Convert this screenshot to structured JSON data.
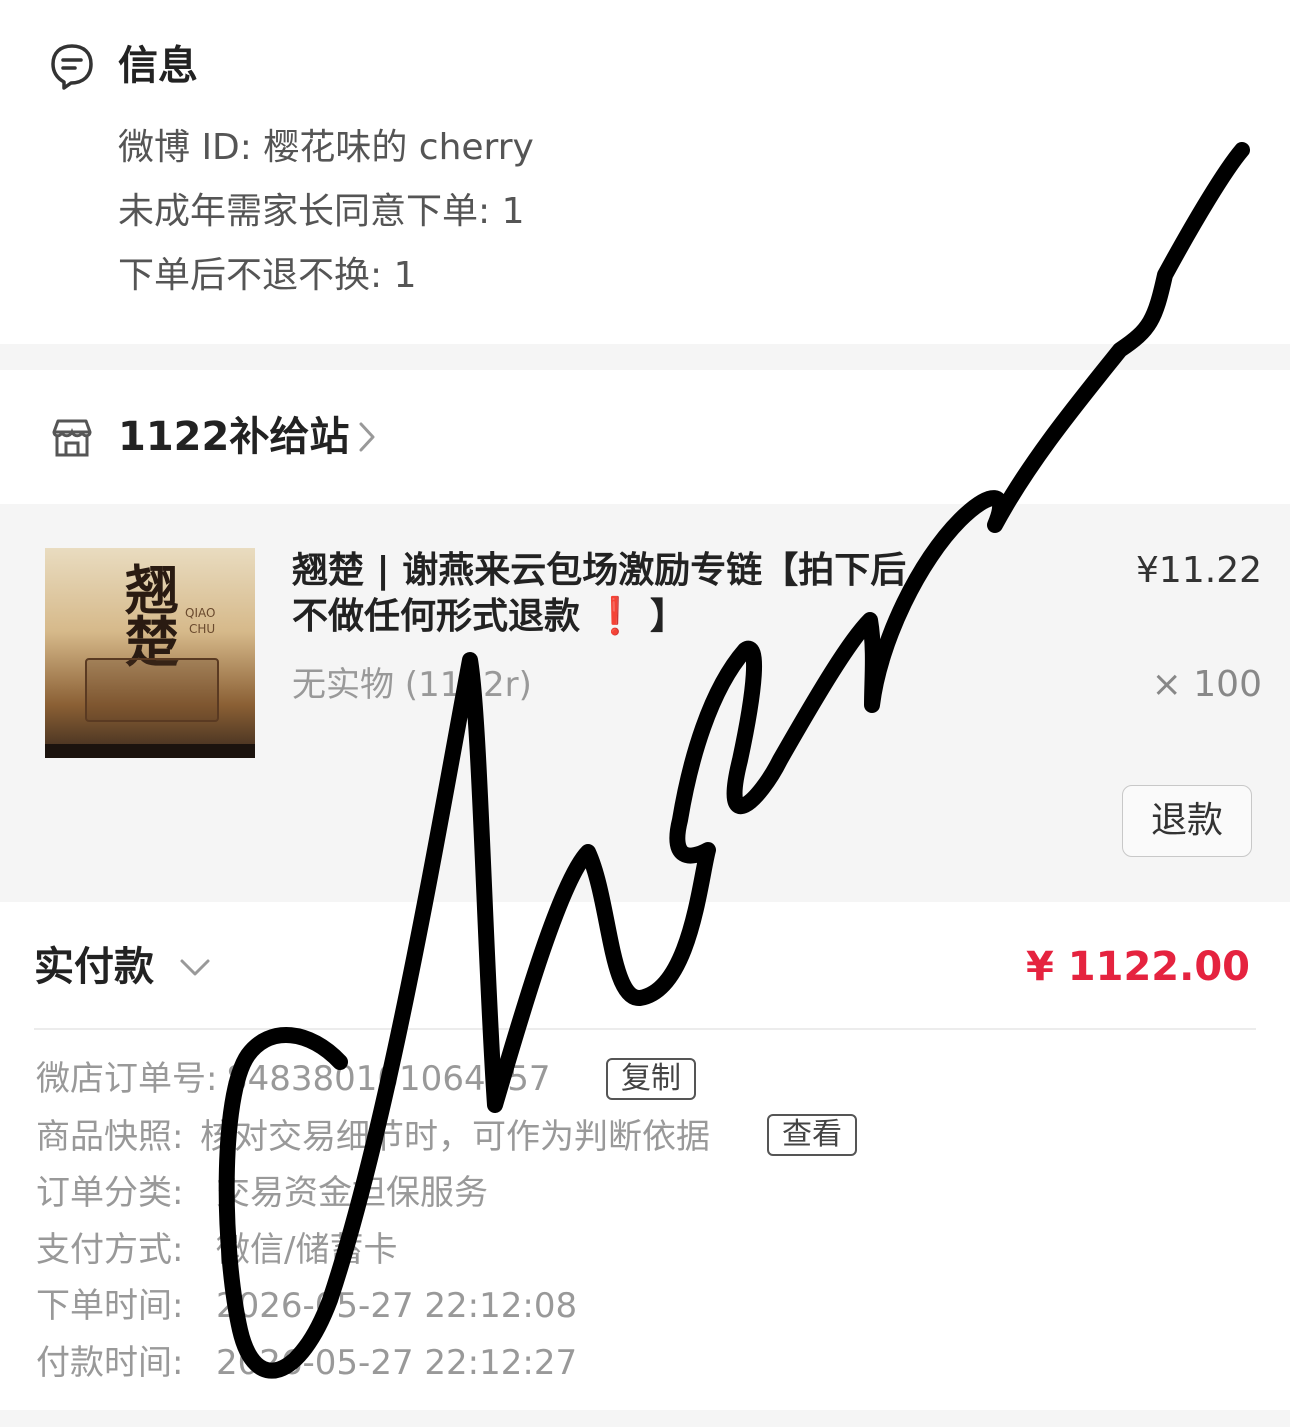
{
  "info": {
    "title": "信息",
    "weibo_id": "微博 ID: 樱花味的 cherry",
    "minor_consent": "未成年需家长同意下单: 1",
    "no_return": "下单后不退不换: 1"
  },
  "shop": {
    "name": "1122补给站"
  },
  "product": {
    "thumb_title_1": "翘",
    "thumb_title_2": "楚",
    "thumb_en_1": "QIAO",
    "thumb_en_2": "CHU",
    "title": "翘楚 | 谢燕来云包场激励专链【拍下后不做任何形式退款",
    "title_mark": "❗",
    "title_end": "】",
    "spec": "无实物 (1122r)",
    "price": "¥11.22",
    "quantity": "× 100",
    "refund_label": "退款"
  },
  "payment": {
    "label": "实付款",
    "amount": "¥ 1122.00"
  },
  "details": {
    "order_no_label": "微店订单号:",
    "order_no_value": "848380101064757",
    "copy_label": "复制",
    "snapshot_label": "商品快照:",
    "snapshot_value": "核对交易细节时，可作为判断依据",
    "view_label": "查看",
    "category_label": "订单分类:",
    "category_value": "交易资金担保服务",
    "pay_method_label": "支付方式:",
    "pay_method_value": "微信/储蓄卡",
    "order_time_label": "下单时间:",
    "order_time_value": "2026-05-27 22:12:08",
    "pay_time_label": "付款时间:",
    "pay_time_value": "2026-05-27 22:12:27"
  },
  "colors": {
    "accent_red": "#e5233f",
    "card_bg": "#f5f5f5",
    "text_gray": "#999999"
  }
}
